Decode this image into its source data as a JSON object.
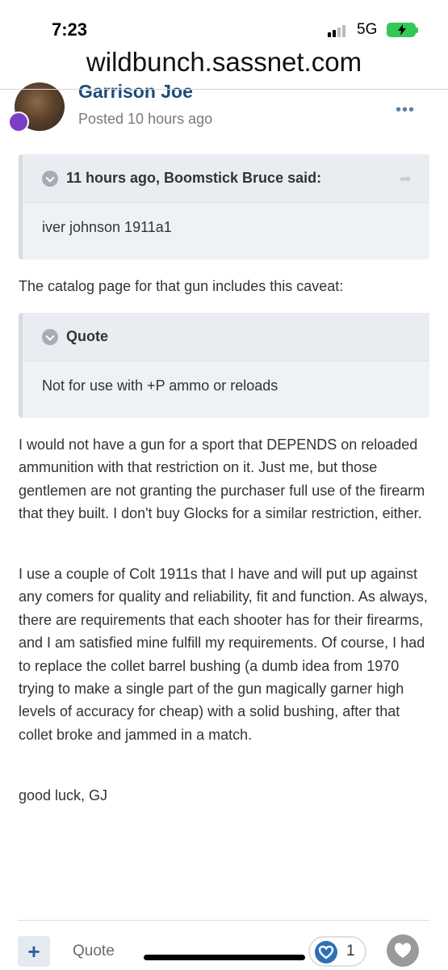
{
  "status_bar": {
    "time": "7:23",
    "network": "5G"
  },
  "browser": {
    "url": "wildbunch.sassnet.com"
  },
  "post": {
    "author": "Garrison Joe",
    "posted": "Posted 10 hours ago",
    "more_icon": "more-dots-icon",
    "quote1": {
      "header": "11 hours ago, Boomstick Bruce said:",
      "body": "iver johnson 1911a1"
    },
    "para1": "The catalog page for that gun includes this caveat:",
    "quote2": {
      "header": "Quote",
      "body": "Not for use with +P ammo or reloads"
    },
    "para2": "I would not have a gun for a sport that DEPENDS on reloaded ammunition with that restriction on it.  Just me, but those gentlemen are not granting the purchaser full use of the firearm that they built.  I don't buy Glocks for a similar restriction, either.",
    "para3": "I use a couple of Colt 1911s that I have and will put up against any comers for quality and reliability, fit and function.  As always, there are requirements that each shooter has for their firearms, and I am satisfied mine fulfill my requirements.  Of course, I had to replace the collet barrel bushing (a dumb idea from 1970 trying to make a single part of the gun magically garner high levels of accuracy for cheap) with a solid bushing, after that collet broke and jammed in a match.",
    "para4": "good luck, GJ"
  },
  "footer": {
    "plus_label": "+",
    "quote_label": "Quote",
    "like_count": "1"
  },
  "colors": {
    "accent": "#2f6fb3",
    "author": "#1d4a7a",
    "badge": "#7b3fc7",
    "battery": "#35c759"
  }
}
